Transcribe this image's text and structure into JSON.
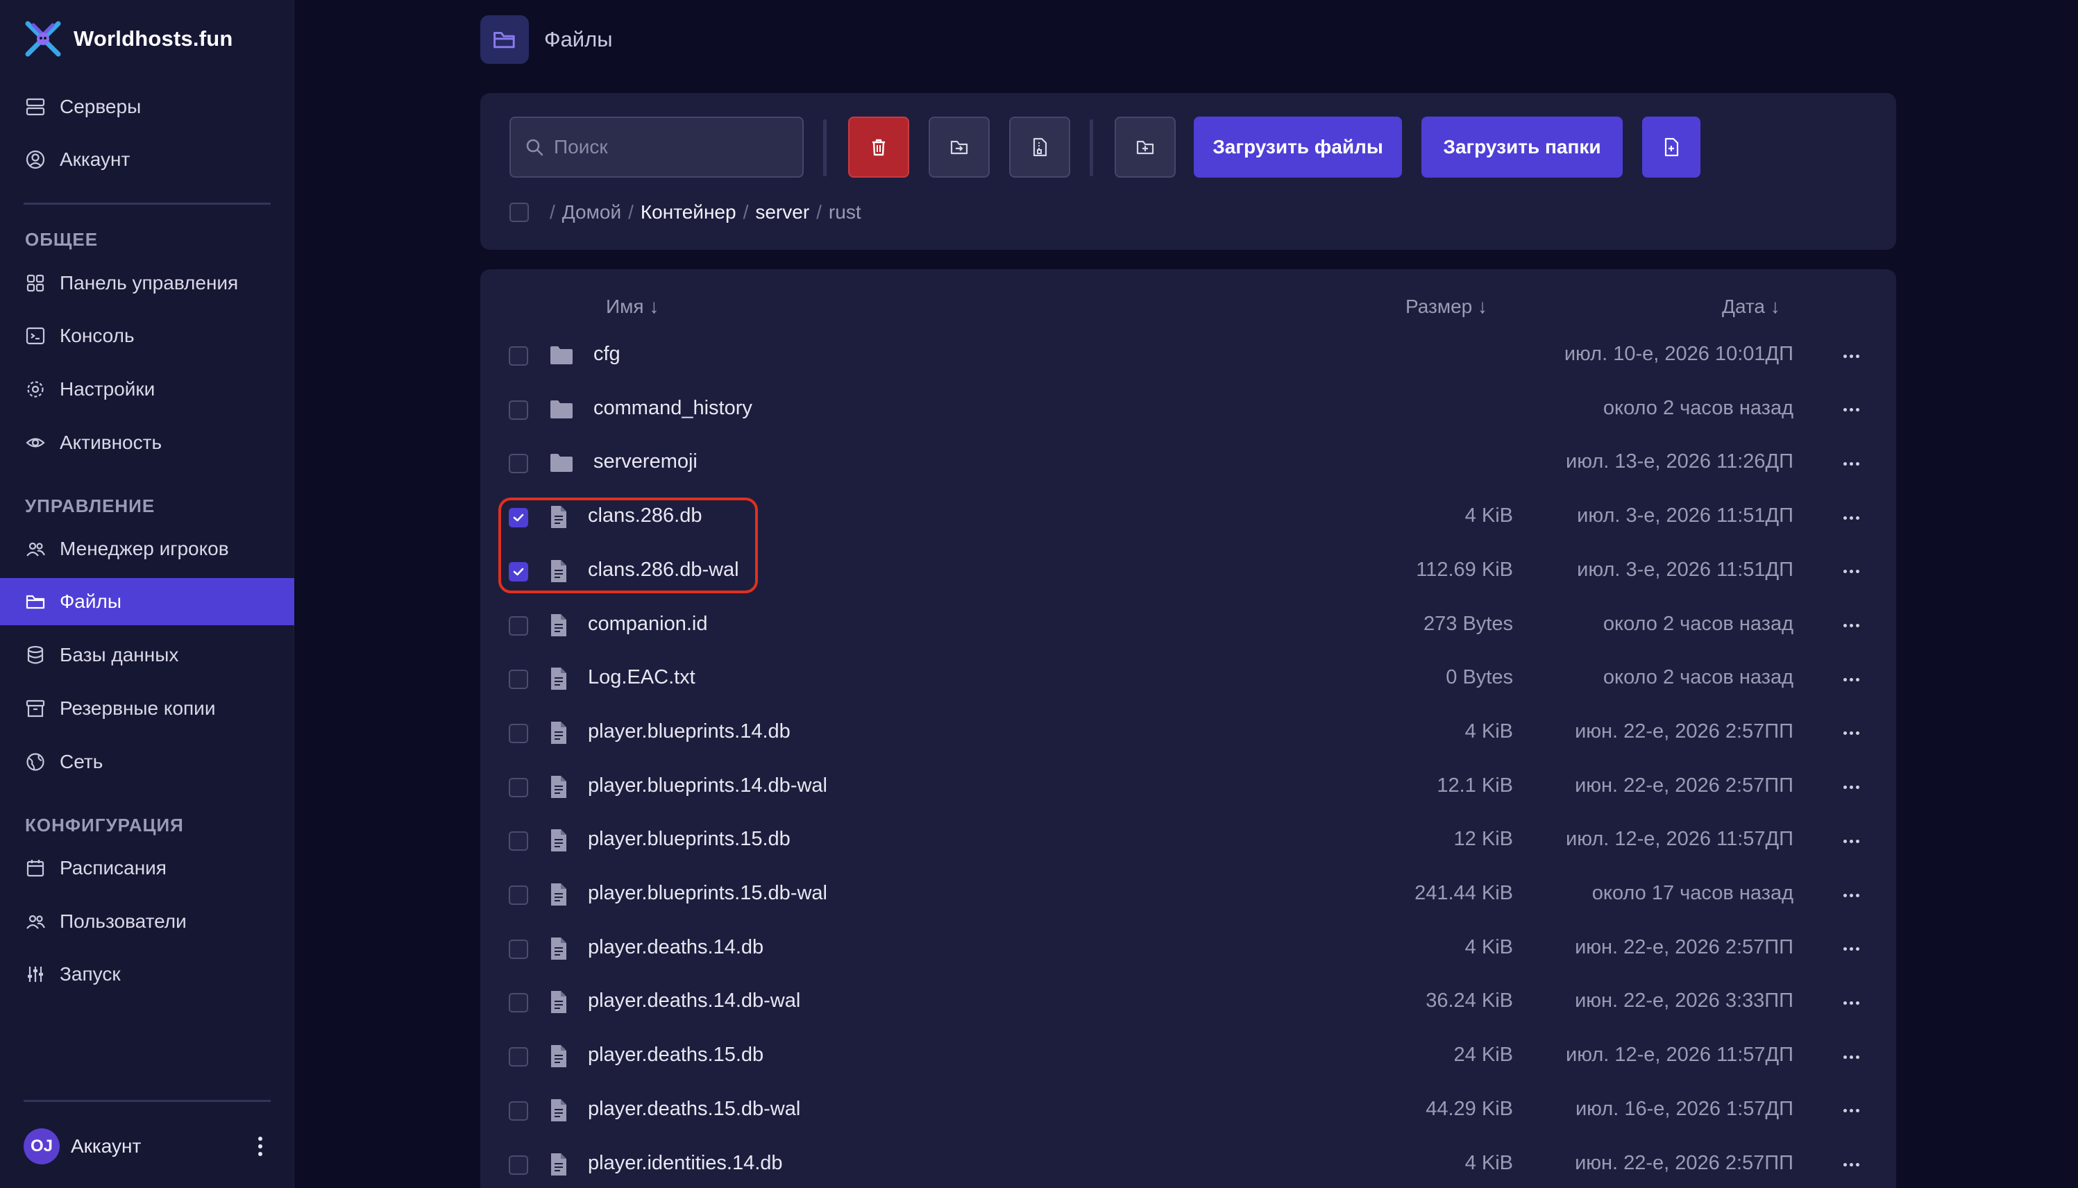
{
  "sidebar": {
    "brand": "Worldhosts.fun",
    "top_items": [
      {
        "label": "Серверы",
        "icon": "server-icon"
      },
      {
        "label": "Аккаунт",
        "icon": "user-circle-icon"
      }
    ],
    "sections": [
      {
        "title": "ОБЩЕЕ",
        "items": [
          {
            "label": "Панель управления",
            "icon": "dashboard-icon"
          },
          {
            "label": "Консоль",
            "icon": "terminal-icon"
          },
          {
            "label": "Настройки",
            "icon": "gear-icon"
          },
          {
            "label": "Активность",
            "icon": "eye-icon"
          }
        ]
      },
      {
        "title": "УПРАВЛЕНИЕ",
        "items": [
          {
            "label": "Менеджер игроков",
            "icon": "users-icon"
          },
          {
            "label": "Файлы",
            "icon": "folder-icon",
            "active": true
          },
          {
            "label": "Базы данных",
            "icon": "database-icon"
          },
          {
            "label": "Резервные копии",
            "icon": "archive-icon"
          },
          {
            "label": "Сеть",
            "icon": "globe-icon"
          }
        ]
      },
      {
        "title": "КОНФИГУРАЦИЯ",
        "items": [
          {
            "label": "Расписания",
            "icon": "calendar-icon"
          },
          {
            "label": "Пользователи",
            "icon": "users-icon"
          },
          {
            "label": "Запуск",
            "icon": "sliders-icon"
          }
        ]
      }
    ],
    "account": {
      "initials": "OJ",
      "label": "Аккаунт"
    }
  },
  "header": {
    "title": "Файлы",
    "icon": "folder-open-icon"
  },
  "toolbar": {
    "search_placeholder": "Поиск",
    "upload_files_label": "Загрузить файлы",
    "upload_folders_label": "Загрузить папки",
    "buttons": [
      "trash-icon",
      "move-file-icon",
      "archive-file-icon",
      "new-folder-icon",
      "new-file-icon"
    ]
  },
  "breadcrumb": {
    "segments": [
      "Домой",
      "Контейнер",
      "server",
      "rust"
    ]
  },
  "table": {
    "columns": {
      "name": "Имя ↓",
      "size": "Размер ↓",
      "date": "Дата ↓"
    },
    "rows": [
      {
        "name": "cfg",
        "type": "folder",
        "size": "",
        "date": "июл. 10-е, 2026 10:01ДП",
        "checked": false
      },
      {
        "name": "command_history",
        "type": "folder",
        "size": "",
        "date": "около 2 часов назад",
        "checked": false
      },
      {
        "name": "serveremoji",
        "type": "folder",
        "size": "",
        "date": "июл. 13-е, 2026 11:26ДП",
        "checked": false
      },
      {
        "name": "clans.286.db",
        "type": "file",
        "size": "4 KiB",
        "date": "июл. 3-е, 2026 11:51ДП",
        "checked": true
      },
      {
        "name": "clans.286.db-wal",
        "type": "file",
        "size": "112.69 KiB",
        "date": "июл. 3-е, 2026 11:51ДП",
        "checked": true
      },
      {
        "name": "companion.id",
        "type": "file",
        "size": "273 Bytes",
        "date": "около 2 часов назад",
        "checked": false
      },
      {
        "name": "Log.EAC.txt",
        "type": "file",
        "size": "0 Bytes",
        "date": "около 2 часов назад",
        "checked": false
      },
      {
        "name": "player.blueprints.14.db",
        "type": "file",
        "size": "4 KiB",
        "date": "июн. 22-е, 2026 2:57ПП",
        "checked": false
      },
      {
        "name": "player.blueprints.14.db-wal",
        "type": "file",
        "size": "12.1 KiB",
        "date": "июн. 22-е, 2026 2:57ПП",
        "checked": false
      },
      {
        "name": "player.blueprints.15.db",
        "type": "file",
        "size": "12 KiB",
        "date": "июл. 12-е, 2026 11:57ДП",
        "checked": false
      },
      {
        "name": "player.blueprints.15.db-wal",
        "type": "file",
        "size": "241.44 KiB",
        "date": "около 17 часов назад",
        "checked": false
      },
      {
        "name": "player.deaths.14.db",
        "type": "file",
        "size": "4 KiB",
        "date": "июн. 22-е, 2026 2:57ПП",
        "checked": false
      },
      {
        "name": "player.deaths.14.db-wal",
        "type": "file",
        "size": "36.24 KiB",
        "date": "июн. 22-е, 2026 3:33ПП",
        "checked": false
      },
      {
        "name": "player.deaths.15.db",
        "type": "file",
        "size": "24 KiB",
        "date": "июл. 12-е, 2026 11:57ДП",
        "checked": false
      },
      {
        "name": "player.deaths.15.db-wal",
        "type": "file",
        "size": "44.29 KiB",
        "date": "июл. 16-е, 2026 1:57ДП",
        "checked": false
      },
      {
        "name": "player.identities.14.db",
        "type": "file",
        "size": "4 KiB",
        "date": "июн. 22-е, 2026 2:57ПП",
        "checked": false
      }
    ]
  },
  "colors": {
    "accent": "#4f3fd6",
    "danger": "#b3262d",
    "highlight": "#e0301e",
    "sidebar_bg": "#161733",
    "page_bg": "#0c0c24",
    "card_bg": "#1d1e3d"
  }
}
